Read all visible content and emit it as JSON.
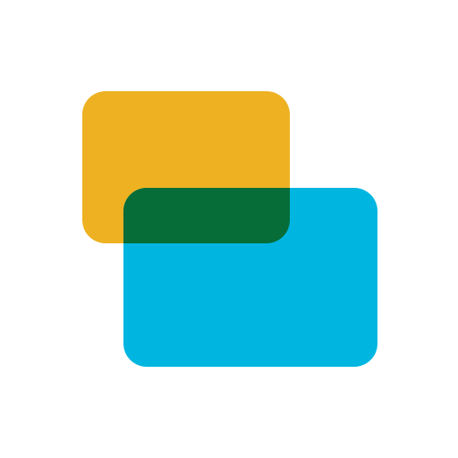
{
  "logo": {
    "icon": "overlapping-cards-icon",
    "colors": {
      "background": "#ffffff",
      "back_card": "#EDB122",
      "front_card": "#00B6E0",
      "overlap": "#066C38"
    }
  }
}
